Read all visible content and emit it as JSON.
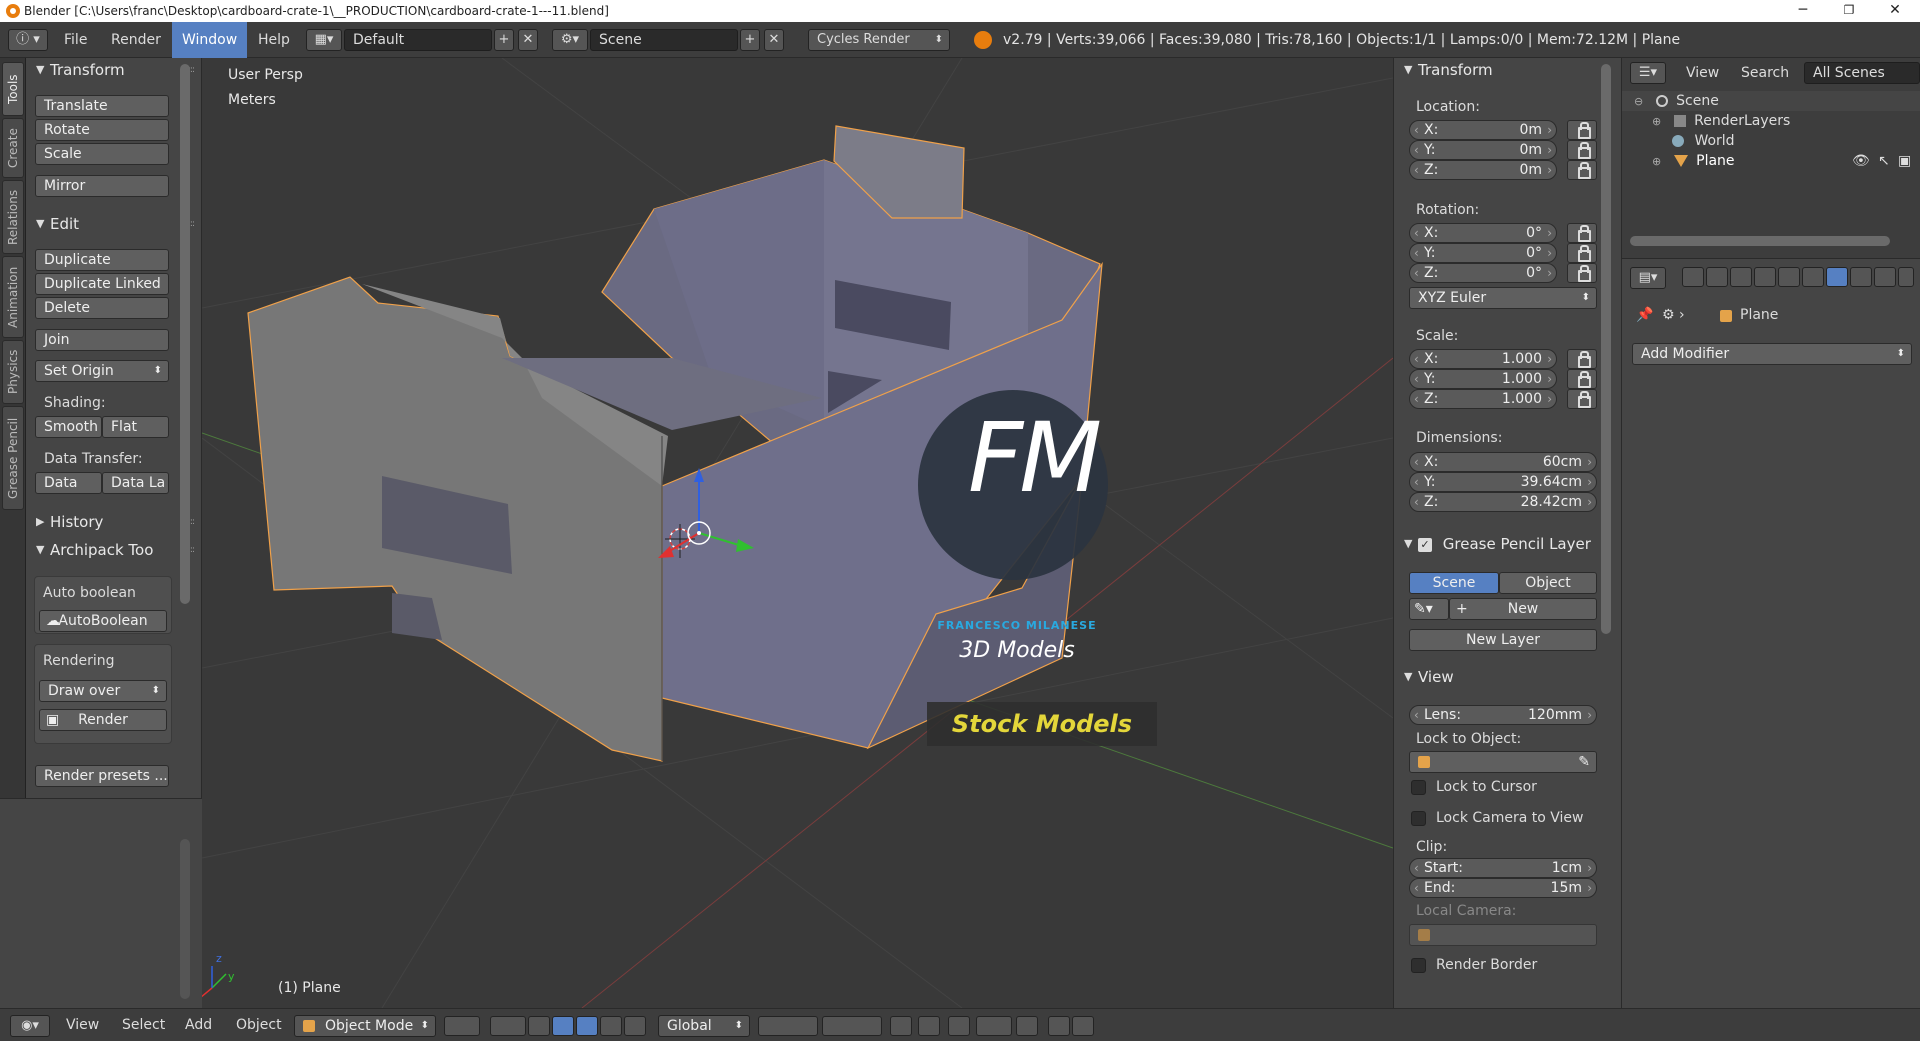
{
  "window": {
    "title": "Blender [C:\\Users\\franc\\Desktop\\cardboard-crate-1\\__PRODUCTION\\cardboard-crate-1---11.blend]",
    "minimize": "─",
    "maximize": "❐",
    "close": "✕"
  },
  "topbar": {
    "menus": [
      "File",
      "Render",
      "Window",
      "Help"
    ],
    "active_menu": "Window",
    "layout": "Default",
    "scene": "Scene",
    "engine": "Cycles Render",
    "stats": "v2.79 | Verts:39,066 | Faces:39,080 | Tris:78,160 | Objects:1/1 | Lamps:0/0 | Mem:72.12M | Plane"
  },
  "left_tabs": [
    "Tools",
    "Create",
    "Relations",
    "Animation",
    "Physics",
    "Grease Pencil"
  ],
  "toolshelf": {
    "transform_header": "Transform",
    "transform_buttons": [
      "Translate",
      "Rotate",
      "Scale"
    ],
    "mirror": "Mirror",
    "edit_header": "Edit",
    "edit_buttons": [
      "Duplicate",
      "Duplicate Linked",
      "Delete"
    ],
    "join": "Join",
    "set_origin": "Set Origin",
    "shading_label": "Shading:",
    "smooth": "Smooth",
    "flat": "Flat",
    "data_transfer_label": "Data Transfer:",
    "data": "Data",
    "data_la": "Data La",
    "history_header": "History",
    "archipack_header": "Archipack Too",
    "auto_boolean_label": "Auto boolean",
    "auto_boolean_btn": "AutoBoolean",
    "rendering_label": "Rendering",
    "draw_over": "Draw over",
    "render_btn": "Render",
    "render_presets": "Render presets ..."
  },
  "viewport": {
    "view_name": "User Persp",
    "units": "Meters",
    "object_label": "(1) Plane",
    "watermark": {
      "fm": "FM",
      "author": "FRANCESCO MILANESE",
      "models": "3D Models",
      "stock": "Stock Models"
    }
  },
  "npanel": {
    "transform_header": "Transform",
    "location_label": "Location:",
    "location": [
      {
        "k": "X:",
        "v": "0m"
      },
      {
        "k": "Y:",
        "v": "0m"
      },
      {
        "k": "Z:",
        "v": "0m"
      }
    ],
    "rotation_label": "Rotation:",
    "rotation": [
      {
        "k": "X:",
        "v": "0°"
      },
      {
        "k": "Y:",
        "v": "0°"
      },
      {
        "k": "Z:",
        "v": "0°"
      }
    ],
    "rotation_mode": "XYZ Euler",
    "scale_label": "Scale:",
    "scale": [
      {
        "k": "X:",
        "v": "1.000"
      },
      {
        "k": "Y:",
        "v": "1.000"
      },
      {
        "k": "Z:",
        "v": "1.000"
      }
    ],
    "dimensions_label": "Dimensions:",
    "dimensions": [
      {
        "k": "X:",
        "v": "60cm"
      },
      {
        "k": "Y:",
        "v": "39.64cm"
      },
      {
        "k": "Z:",
        "v": "28.42cm"
      }
    ],
    "gp_header": "Grease Pencil Layer",
    "gp_scene": "Scene",
    "gp_object": "Object",
    "gp_new": "New",
    "gp_new_layer": "New Layer",
    "view_header": "View",
    "lens_k": "Lens:",
    "lens_v": "120mm",
    "lock_to_object": "Lock to Object:",
    "lock_to_cursor": "Lock to Cursor",
    "lock_camera": "Lock Camera to View",
    "clip_label": "Clip:",
    "clip_start_k": "Start:",
    "clip_start_v": "1cm",
    "clip_end_k": "End:",
    "clip_end_v": "15m",
    "local_camera": "Local Camera:",
    "render_border": "Render Border"
  },
  "outliner": {
    "view": "View",
    "search": "Search",
    "all_scenes": "All Scenes",
    "rows": [
      "Scene",
      "RenderLayers",
      "World",
      "Plane"
    ]
  },
  "properties": {
    "object_name": "Plane",
    "add_modifier": "Add Modifier"
  },
  "bottombar": {
    "menus": [
      "View",
      "Select",
      "Add",
      "Object"
    ],
    "mode": "Object Mode",
    "orientation": "Global"
  },
  "colors": {
    "accent": "#5680c2",
    "viewport_bg": "#393939",
    "panel_bg": "#454545",
    "header_bg": "#3d3d3d",
    "watermark_blue": "#29a9e0",
    "watermark_yellow": "#e3d63a",
    "selection_outline": "#f0a14a"
  }
}
